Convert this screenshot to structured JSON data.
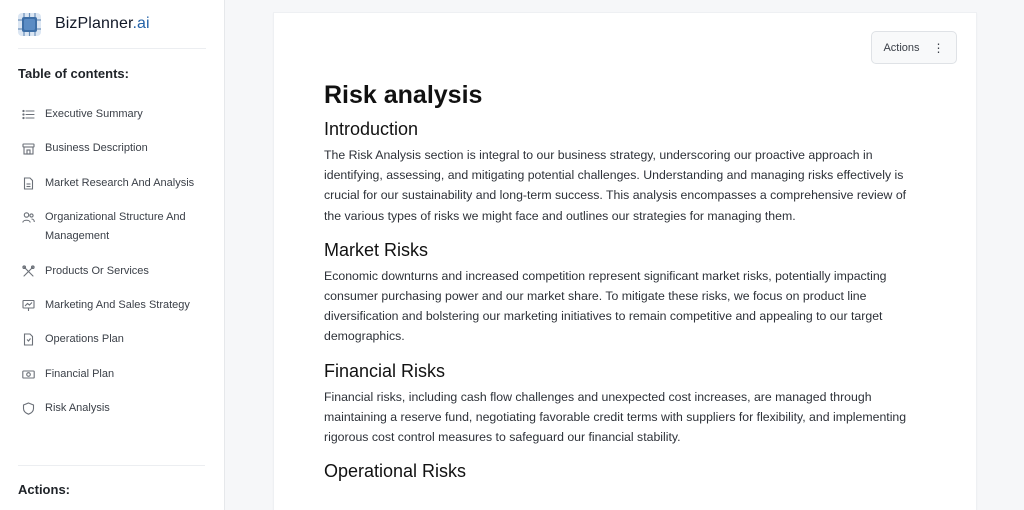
{
  "brand": {
    "name": "BizPlanner",
    "suffix": ".ai"
  },
  "sidebar": {
    "toc_title": "Table of contents:",
    "items": [
      {
        "label": "Executive Summary",
        "icon": "list-icon"
      },
      {
        "label": "Business Description",
        "icon": "building-icon"
      },
      {
        "label": "Market Research And Analysis",
        "icon": "document-icon"
      },
      {
        "label": "Organizational Structure And Management",
        "icon": "users-icon"
      },
      {
        "label": "Products Or Services",
        "icon": "tools-icon"
      },
      {
        "label": "Marketing And Sales Strategy",
        "icon": "presentation-icon"
      },
      {
        "label": "Operations Plan",
        "icon": "file-icon"
      },
      {
        "label": "Financial Plan",
        "icon": "cash-icon"
      },
      {
        "label": "Risk Analysis",
        "icon": "shield-icon"
      }
    ],
    "actions_title": "Actions:"
  },
  "toolbar": {
    "actions_label": "Actions",
    "more_glyph": "⋮"
  },
  "document": {
    "title": "Risk analysis",
    "sections": [
      {
        "heading": "Introduction",
        "body": "The Risk Analysis section is integral to our business strategy, underscoring our proactive approach in identifying, assessing, and mitigating potential challenges. Understanding and managing risks effectively is crucial for our sustainability and long-term success. This analysis encompasses a comprehensive review of the various types of risks we might face and outlines our strategies for managing them."
      },
      {
        "heading": "Market Risks",
        "body": "Economic downturns and increased competition represent significant market risks, potentially impacting consumer purchasing power and our market share. To mitigate these risks, we focus on product line diversification and bolstering our marketing initiatives to remain competitive and appealing to our target demographics."
      },
      {
        "heading": "Financial Risks",
        "body": "Financial risks, including cash flow challenges and unexpected cost increases, are managed through maintaining a reserve fund, negotiating favorable credit terms with suppliers for flexibility, and implementing rigorous cost control measures to safeguard our financial stability."
      },
      {
        "heading": "Operational Risks",
        "body": ""
      }
    ]
  },
  "colors": {
    "accent": "#2563a8",
    "sidebar_bg": "#ffffff",
    "page_bg": "#f6f7f9"
  }
}
